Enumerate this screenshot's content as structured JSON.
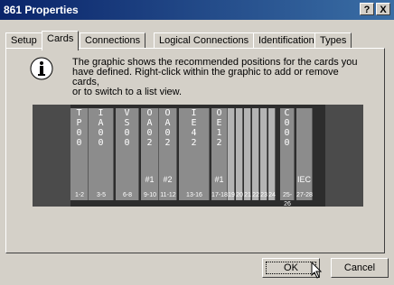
{
  "window": {
    "title": "861 Properties",
    "help_label": "?",
    "close_label": "X"
  },
  "tabs": [
    {
      "label": "Setup"
    },
    {
      "label": "Cards",
      "active": true
    },
    {
      "label": "Connections"
    },
    {
      "label": "Logical Connections"
    },
    {
      "label": "Identification"
    },
    {
      "label": "Types"
    }
  ],
  "info": {
    "icon": "info-icon",
    "line1": "The graphic shows the recommended positions for the cards you",
    "line2": "have defined. Right-click within the graphic to add or remove cards,",
    "line3": "or to switch to a list view."
  },
  "rack": {
    "slots": [
      {
        "label": "T\nP\n0\n0",
        "num": "1-2"
      },
      {
        "label": "I\nA\n0\n0",
        "num": "3-5"
      },
      {
        "label": "V\nS\n0\n0",
        "num": "6-8"
      },
      {
        "label": "O\nA\n0\n2",
        "note": "#1",
        "num": "9-10"
      },
      {
        "label": "O\nA\n0\n2",
        "note": "#2",
        "num": "11-12"
      },
      {
        "label": "I\nE\n4\n2",
        "num": "13-16"
      },
      {
        "label": "O\nE\n1\n2",
        "note": "#1",
        "num": "17-18"
      },
      {
        "label": "",
        "num": "19"
      },
      {
        "label": "",
        "num": "20"
      },
      {
        "label": "",
        "num": "21"
      },
      {
        "label": "",
        "num": "22"
      },
      {
        "label": "",
        "num": "23"
      },
      {
        "label": "",
        "num": "24"
      },
      {
        "label": "C\n0\n0\n0",
        "num": "25-26"
      },
      {
        "label": "",
        "note": "IEC",
        "num": "27-28"
      }
    ]
  },
  "buttons": {
    "ok": "OK",
    "cancel": "Cancel"
  }
}
